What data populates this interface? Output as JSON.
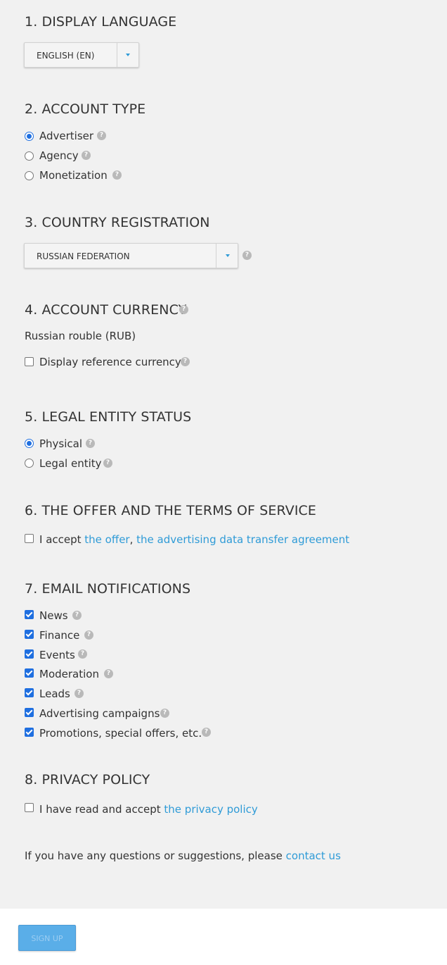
{
  "display_language": {
    "title": "1. DISPLAY LANGUAGE",
    "selected": "ENGLISH (EN)"
  },
  "account_type": {
    "title": "2. ACCOUNT TYPE",
    "options": [
      "Advertiser",
      "Agency",
      "Monetization"
    ],
    "selected": "Advertiser"
  },
  "country": {
    "title": "3. COUNTRY REGISTRATION",
    "selected": "RUSSIAN FEDERATION"
  },
  "currency": {
    "title": "4. ACCOUNT CURRENCY",
    "value": "Russian rouble (RUB)",
    "reference_label": "Display reference currency",
    "reference_checked": false
  },
  "legal_status": {
    "title": "5. LEGAL ENTITY STATUS",
    "options": [
      "Physical",
      "Legal entity"
    ],
    "selected": "Physical"
  },
  "offer": {
    "title": "6. THE OFFER AND THE TERMS OF SERVICE",
    "accept_prefix": "I accept",
    "offer_link": "the offer",
    "separator": ",",
    "agreement_link": "the advertising data transfer agreement",
    "checked": false
  },
  "notifications": {
    "title": "7. EMAIL NOTIFICATIONS",
    "items": [
      {
        "label": "News",
        "checked": true
      },
      {
        "label": "Finance",
        "checked": true
      },
      {
        "label": "Events",
        "checked": true
      },
      {
        "label": "Moderation",
        "checked": true
      },
      {
        "label": "Leads",
        "checked": true
      },
      {
        "label": "Advertising campaigns",
        "checked": true
      },
      {
        "label": "Promotions, special offers, etc.",
        "checked": true
      }
    ]
  },
  "privacy": {
    "title": "8. PRIVACY POLICY",
    "accept_prefix": "I have read and accept",
    "link": "the privacy policy",
    "checked": false
  },
  "contact": {
    "text": "If you have any questions or suggestions, please",
    "link": "contact us"
  },
  "help_glyph": "?",
  "signup_label": "SIGN UP",
  "colors": {
    "accent": "#1f6fe0",
    "link": "#2f9bd7",
    "button": "#5aaee8",
    "background": "#f1f1f1"
  }
}
